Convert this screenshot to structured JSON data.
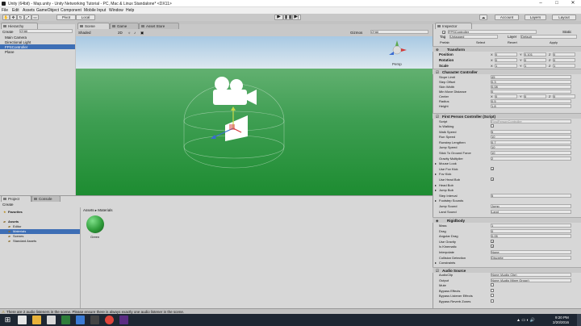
{
  "window": {
    "title": "Unity (64bit) - Map.unity - Unity Networking Tutorial - PC, Mac & Linux Standalone* <DX11>",
    "controls": [
      "–",
      "□",
      "✕"
    ]
  },
  "menu": [
    "File",
    "Edit",
    "Assets",
    "GameObject",
    "Component",
    "Mobile Input",
    "Window",
    "Help"
  ],
  "toolbar": {
    "pivot": "Pivot",
    "local": "Local",
    "account": "Account",
    "layers": "Layers",
    "layout": "Layout"
  },
  "hierarchy": {
    "tab": "Hierarchy",
    "create": "Create",
    "search": "Q*All",
    "items": [
      "Main Camera",
      "Directional Light",
      "FPSController",
      "Plane"
    ],
    "selected_index": 2
  },
  "scene": {
    "tabs": [
      "Scene",
      "Game",
      "Asset Store"
    ],
    "shading": "Shaded",
    "mode_2d": "2D",
    "gizmos": "Gizmos",
    "search": "Q*All",
    "persp": "Persp"
  },
  "inspector": {
    "tab": "Inspector",
    "object_name": "FPSController",
    "static": "Static",
    "tag_label": "Tag",
    "tag": "Untagged",
    "layer_label": "Layer",
    "layer": "Default",
    "prefab_label": "Prefab",
    "prefab_buttons": [
      "Select",
      "Revert",
      "Apply"
    ],
    "transform": {
      "title": "Transform",
      "rows": [
        {
          "label": "Position",
          "x": "0",
          "y": "0.101",
          "z": "0"
        },
        {
          "label": "Rotation",
          "x": "0",
          "y": "0",
          "z": "0"
        },
        {
          "label": "Scale",
          "x": "1",
          "y": "1",
          "z": "1"
        }
      ]
    },
    "cc": {
      "title": "Character Controller",
      "rows": [
        {
          "label": "Slope Limit",
          "value": "45"
        },
        {
          "label": "Step Offset",
          "value": "0.3"
        },
        {
          "label": "Skin Width",
          "value": "0.08"
        },
        {
          "label": "Min Move Distance",
          "value": "0"
        }
      ],
      "center": {
        "label": "Center",
        "x": "0",
        "y": "0",
        "z": "0"
      },
      "rows2": [
        {
          "label": "Radius",
          "value": "0.5"
        },
        {
          "label": "Height",
          "value": "1.8"
        }
      ]
    },
    "fpc": {
      "title": "First Person Controller (Script)",
      "script_label": "Script",
      "script": "FirstPersonController",
      "rows": [
        {
          "label": "Is Walking",
          "kind": "check",
          "checked": false
        },
        {
          "label": "Walk Speed",
          "value": "5"
        },
        {
          "label": "Run Speed",
          "value": "10"
        },
        {
          "label": "Runstep Lengthen",
          "value": "0.7"
        },
        {
          "label": "Jump Speed",
          "value": "10"
        },
        {
          "label": "Stick To Ground Force",
          "value": "10"
        },
        {
          "label": "Gravity Multiplier",
          "value": "2"
        },
        {
          "label": "Mouse Look",
          "kind": "fold"
        },
        {
          "label": "Use Fov Kick",
          "kind": "check",
          "checked": true
        },
        {
          "label": "Fov Kick",
          "kind": "fold"
        },
        {
          "label": "Use Head Bob",
          "kind": "check",
          "checked": true
        },
        {
          "label": "Head Bob",
          "kind": "fold"
        },
        {
          "label": "Jump Bob",
          "kind": "fold"
        },
        {
          "label": "Step Interval",
          "value": "5"
        },
        {
          "label": "Footstep Sounds",
          "kind": "fold"
        },
        {
          "label": "Jump Sound",
          "value": "Jump"
        },
        {
          "label": "Land Sound",
          "value": "Land"
        }
      ]
    },
    "rb": {
      "title": "Rigidbody",
      "rows": [
        {
          "label": "Mass",
          "value": "1"
        },
        {
          "label": "Drag",
          "value": "0"
        },
        {
          "label": "Angular Drag",
          "value": "0.05"
        },
        {
          "label": "Use Gravity",
          "kind": "check",
          "checked": true
        },
        {
          "label": "Is Kinematic",
          "kind": "check",
          "checked": true
        },
        {
          "label": "Interpolate",
          "value": "None"
        },
        {
          "label": "Collision Detection",
          "value": "Discrete"
        },
        {
          "label": "Constraints",
          "kind": "fold"
        }
      ]
    },
    "audio": {
      "title": "Audio Source",
      "rows": [
        {
          "label": "AudioClip",
          "value": "None (Audio Clip)"
        },
        {
          "label": "Output",
          "value": "None (Audio Mixer Group)"
        },
        {
          "label": "Mute",
          "kind": "check",
          "checked": false
        },
        {
          "label": "Bypass Effects",
          "kind": "check",
          "checked": false
        },
        {
          "label": "Bypass Listener Effects",
          "kind": "check",
          "checked": false
        },
        {
          "label": "Bypass Reverb Zones",
          "kind": "check",
          "checked": false
        }
      ]
    }
  },
  "project": {
    "tabs": [
      "Project",
      "Console"
    ],
    "create": "Create",
    "tree": [
      {
        "label": "Favorites",
        "level": 0
      },
      {
        "label": "Assets",
        "level": 0
      },
      {
        "label": "Editor",
        "level": 1
      },
      {
        "label": "Materials",
        "level": 1
      },
      {
        "label": "Scenes",
        "level": 1
      },
      {
        "label": "Standard Assets",
        "level": 1
      }
    ],
    "tree_selected": 3,
    "breadcrumb": [
      "Assets",
      "Materials"
    ],
    "items": [
      {
        "name": "Green",
        "color": "#2f9c3a"
      }
    ]
  },
  "status": "There are 2 audio listeners in the scene. Please ensure there is always exactly one audio listener in the scene.",
  "taskbar": {
    "time": "9:20 PM",
    "date": "2/20/2016"
  },
  "colors": {
    "ground": "#3e9e52",
    "sky": "#a8c9e3",
    "selection": "#3d6eb5",
    "taskbar": "#1e2733"
  }
}
